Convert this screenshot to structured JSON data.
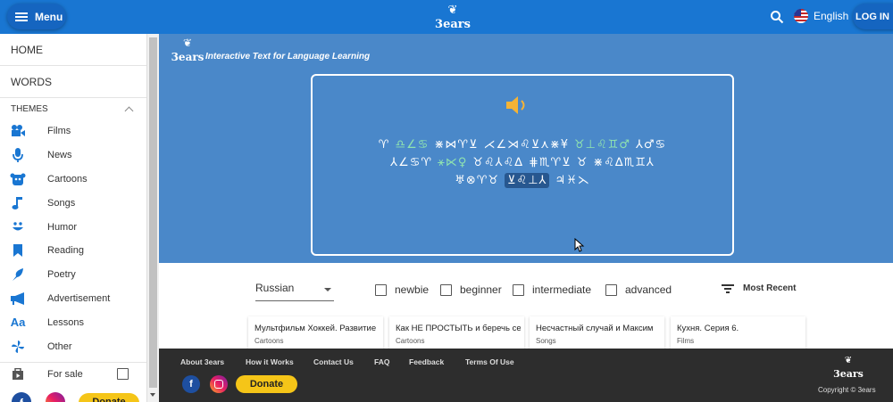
{
  "header": {
    "menu_label": "Menu",
    "logo_text": "3ears",
    "language": "English",
    "login_label": "LOG IN"
  },
  "sidebar": {
    "home": "HOME",
    "words": "WORDS",
    "themes_label": "THEMES",
    "themes": [
      {
        "label": "Films",
        "icon": "film-camera-icon"
      },
      {
        "label": "News",
        "icon": "microphone-icon"
      },
      {
        "label": "Cartoons",
        "icon": "cartoon-face-icon"
      },
      {
        "label": "Songs",
        "icon": "music-note-icon"
      },
      {
        "label": "Humor",
        "icon": "smile-icon"
      },
      {
        "label": "Reading",
        "icon": "bookmark-icon"
      },
      {
        "label": "Poetry",
        "icon": "feather-icon"
      },
      {
        "label": "Advertisement",
        "icon": "megaphone-icon"
      },
      {
        "label": "Lessons",
        "icon": "aa-icon"
      },
      {
        "label": "Other",
        "icon": "pinwheel-icon"
      }
    ],
    "for_sale": "For sale",
    "donate": "Donate"
  },
  "hero": {
    "logo_text": "3ears",
    "tagline": "Interactive Text for Language Learning",
    "lines": [
      [
        {
          "t": "♈",
          "s": ""
        },
        {
          "t": "♎∠♋",
          "s": "g"
        },
        {
          "t": "⋇⋈♈⊻",
          "s": ""
        },
        {
          "t": "⋌∠⋊♌⊻⋏⋇¥",
          "s": ""
        },
        {
          "t": "♉⊥♌♊♂",
          "s": "g"
        },
        {
          "t": "⅄♂♋",
          "s": ""
        }
      ],
      [
        {
          "t": "⅄∠♋♈",
          "s": ""
        },
        {
          "t": "⚹⋉♀",
          "s": "g"
        },
        {
          "t": "♉♌⅄♌∆",
          "s": ""
        },
        {
          "t": "⋕♏♈⊻",
          "s": ""
        },
        {
          "t": "♉",
          "s": ""
        },
        {
          "t": "⋇♌∆♏♊⅄",
          "s": ""
        }
      ],
      [
        {
          "t": "♅⊗♈♉",
          "s": ""
        },
        {
          "t": "⊻♌⊥⅄",
          "s": "hl"
        },
        {
          "t": "♃♓⋋",
          "s": ""
        }
      ]
    ]
  },
  "filters": {
    "language": "Russian",
    "levels": [
      "newbie",
      "beginner",
      "intermediate",
      "advanced"
    ],
    "sort_label": "Most Recent"
  },
  "cards": [
    {
      "title": "Мультфильм Хоккей. Развитие",
      "category": "Cartoons"
    },
    {
      "title": "Как НЕ ПРОСТЫТЬ и беречь себя",
      "category": "Cartoons"
    },
    {
      "title": "Несчастный случай и Максим",
      "category": "Songs"
    },
    {
      "title": "Кухня. Серия 6.",
      "category": "Films"
    }
  ],
  "footer": {
    "links": [
      "About 3ears",
      "How it Works",
      "Contact Us",
      "FAQ",
      "Feedback",
      "Terms Of Use"
    ],
    "donate": "Donate",
    "logo_text": "3ears",
    "copyright": "Copyright © 3ears"
  },
  "colors": {
    "primary": "#1976d2",
    "hero": "#4a88c9",
    "footer": "#2d2d2d",
    "donate": "#f5c518",
    "glyph_highlight": "#8fe3b0"
  }
}
